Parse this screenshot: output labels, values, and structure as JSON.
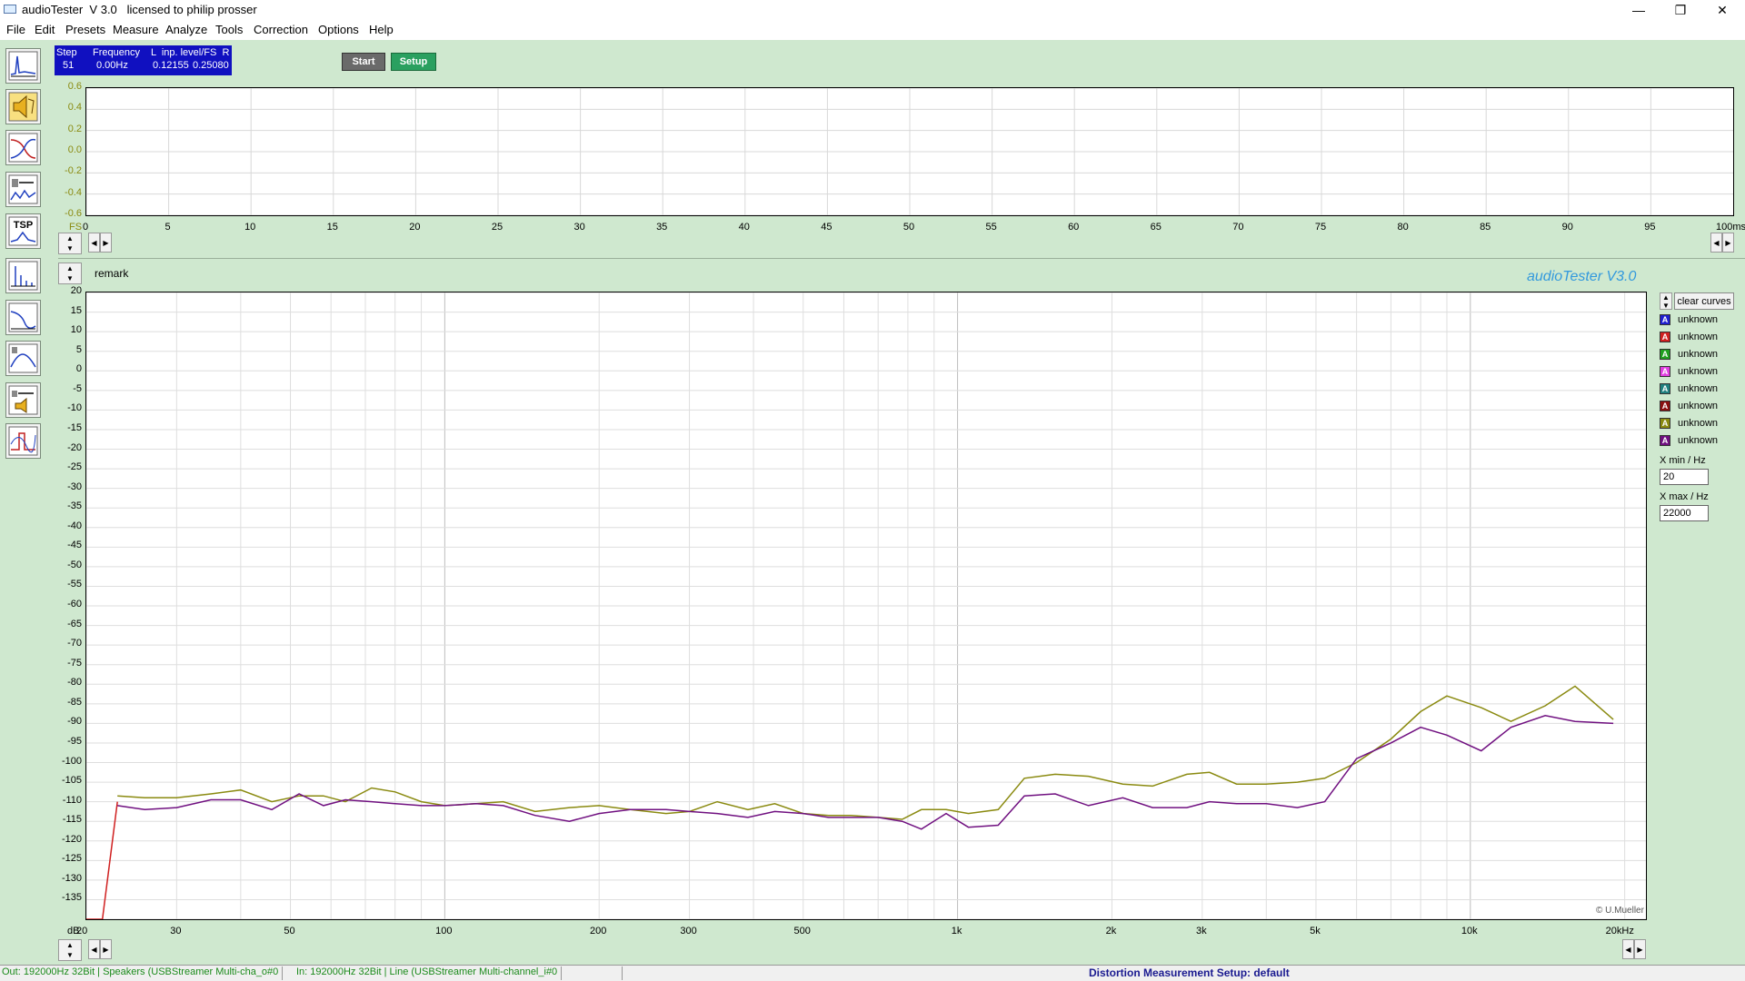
{
  "window": {
    "title": "audioTester  V 3.0   licensed to philip prosser",
    "controls": {
      "minimize": "—",
      "restore": "❐",
      "close": "✕"
    }
  },
  "menu": [
    "File",
    "Edit",
    "Presets",
    "Measure",
    "Analyze",
    "Tools",
    "Correction",
    "Options",
    "Help"
  ],
  "toolbar": {
    "tools": [
      "impulse-tool",
      "speaker-tool",
      "filter-tool",
      "speaker-measure-tool",
      "tsp-tool",
      "spectrum-tool",
      "response-tool",
      "crossover-tool",
      "speaker-compare-tool",
      "step-tool"
    ],
    "tsp_label": "TSP"
  },
  "info": {
    "step_header": "Step",
    "freq_header": "Frequency",
    "level_header": "L  inp. level/FS  R",
    "step_value": "51",
    "freq_value": "0.00Hz",
    "left_value": "0.12155",
    "right_value": "0.25080"
  },
  "buttons": {
    "start": "Start",
    "setup": "Setup"
  },
  "top_plot": {
    "y_ticks": [
      "0.6",
      "0.4",
      "0.2",
      "0.0",
      "-0.2",
      "-0.4",
      "-0.6"
    ],
    "y_unit": "FS",
    "x_ticks": [
      "0",
      "5",
      "10",
      "15",
      "20",
      "25",
      "30",
      "35",
      "40",
      "45",
      "50",
      "55",
      "60",
      "65",
      "70",
      "75",
      "80",
      "85",
      "90",
      "95"
    ],
    "x_unit": "100ms"
  },
  "remark": "remark",
  "brand": "audioTester  V3.0",
  "copyright": "© U.Mueller",
  "legend": {
    "clear_label": "clear curves",
    "curves": [
      {
        "label": "unknown",
        "color": "#2020d0"
      },
      {
        "label": "unknown",
        "color": "#d02020"
      },
      {
        "label": "unknown",
        "color": "#20a020"
      },
      {
        "label": "unknown",
        "color": "#e040e0"
      },
      {
        "label": "unknown",
        "color": "#208080"
      },
      {
        "label": "unknown",
        "color": "#8a1010"
      },
      {
        "label": "unknown",
        "color": "#8a8a10"
      },
      {
        "label": "unknown",
        "color": "#701080"
      }
    ],
    "legend_glyph": "A",
    "xmin_label": "X min / Hz",
    "xmin_value": "20",
    "xmax_label": "X max / Hz",
    "xmax_value": "22000"
  },
  "status": {
    "out": "Out: 192000Hz 32Bit  | Speakers (USBStreamer Multi-cha_o#0",
    "in": "In: 192000Hz 32Bit  | Line (USBStreamer Multi-channel_i#0",
    "setup": "Distortion Measurement Setup:  default"
  },
  "chart_data": {
    "type": "line",
    "title": "",
    "xlabel": "Hz",
    "ylabel": "dB",
    "x_scale": "log",
    "xlim": [
      20,
      22000
    ],
    "ylim": [
      -140,
      20
    ],
    "grid": true,
    "x_tick_labels": [
      {
        "v": 20,
        "t": "20"
      },
      {
        "v": 30,
        "t": "30"
      },
      {
        "v": 50,
        "t": "50"
      },
      {
        "v": 100,
        "t": "100"
      },
      {
        "v": 200,
        "t": "200"
      },
      {
        "v": 300,
        "t": "300"
      },
      {
        "v": 500,
        "t": "500"
      },
      {
        "v": 1000,
        "t": "1k"
      },
      {
        "v": 2000,
        "t": "2k"
      },
      {
        "v": 3000,
        "t": "3k"
      },
      {
        "v": 5000,
        "t": "5k"
      },
      {
        "v": 10000,
        "t": "10k"
      },
      {
        "v": 20000,
        "t": "20kHz"
      }
    ],
    "y_ticks": [
      20,
      15,
      10,
      5,
      0,
      -5,
      -10,
      -15,
      -20,
      -25,
      -30,
      -35,
      -40,
      -45,
      -50,
      -55,
      -60,
      -65,
      -70,
      -75,
      -80,
      -85,
      -90,
      -95,
      -100,
      -105,
      -110,
      -115,
      -120,
      -125,
      -130,
      -135,
      -140
    ],
    "y_unit_label": "dB",
    "series": [
      {
        "color": "#d02020",
        "points": [
          [
            20,
            -140
          ],
          [
            21.5,
            -140
          ],
          [
            23,
            -110
          ]
        ]
      },
      {
        "color": "#8a8a10",
        "points": [
          [
            23,
            -108.5
          ],
          [
            26,
            -109
          ],
          [
            30,
            -109
          ],
          [
            35,
            -108
          ],
          [
            40,
            -107
          ],
          [
            46,
            -110
          ],
          [
            52,
            -108.5
          ],
          [
            58,
            -108.5
          ],
          [
            64,
            -110
          ],
          [
            72,
            -106.5
          ],
          [
            80,
            -107.5
          ],
          [
            90,
            -110
          ],
          [
            100,
            -111
          ],
          [
            115,
            -110.5
          ],
          [
            130,
            -110
          ],
          [
            150,
            -112.5
          ],
          [
            175,
            -111.5
          ],
          [
            200,
            -111
          ],
          [
            230,
            -112
          ],
          [
            270,
            -113
          ],
          [
            300,
            -112.5
          ],
          [
            340,
            -110
          ],
          [
            390,
            -112
          ],
          [
            440,
            -110.5
          ],
          [
            500,
            -113
          ],
          [
            560,
            -113.5
          ],
          [
            620,
            -113.5
          ],
          [
            700,
            -114
          ],
          [
            780,
            -114.5
          ],
          [
            850,
            -112
          ],
          [
            950,
            -112
          ],
          [
            1050,
            -113
          ],
          [
            1200,
            -112
          ],
          [
            1350,
            -104
          ],
          [
            1550,
            -103
          ],
          [
            1800,
            -103.5
          ],
          [
            2100,
            -105.5
          ],
          [
            2400,
            -106
          ],
          [
            2800,
            -103
          ],
          [
            3100,
            -102.5
          ],
          [
            3500,
            -105.5
          ],
          [
            4000,
            -105.5
          ],
          [
            4600,
            -105
          ],
          [
            5200,
            -104
          ],
          [
            6000,
            -100
          ],
          [
            7000,
            -94
          ],
          [
            8000,
            -87
          ],
          [
            9000,
            -83
          ],
          [
            10500,
            -86
          ],
          [
            12000,
            -89.5
          ],
          [
            14000,
            -85.5
          ],
          [
            16000,
            -80.5
          ],
          [
            19000,
            -89
          ]
        ]
      },
      {
        "color": "#701080",
        "points": [
          [
            23,
            -111
          ],
          [
            26,
            -112
          ],
          [
            30,
            -111.5
          ],
          [
            35,
            -109.5
          ],
          [
            40,
            -109.5
          ],
          [
            46,
            -112
          ],
          [
            52,
            -108
          ],
          [
            58,
            -111
          ],
          [
            64,
            -109.5
          ],
          [
            72,
            -110
          ],
          [
            80,
            -110.5
          ],
          [
            90,
            -111
          ],
          [
            100,
            -111
          ],
          [
            115,
            -110.5
          ],
          [
            130,
            -111
          ],
          [
            150,
            -113.5
          ],
          [
            175,
            -115
          ],
          [
            200,
            -113
          ],
          [
            230,
            -112
          ],
          [
            270,
            -112
          ],
          [
            300,
            -112.5
          ],
          [
            340,
            -113
          ],
          [
            390,
            -114
          ],
          [
            440,
            -112.5
          ],
          [
            500,
            -113
          ],
          [
            560,
            -114
          ],
          [
            620,
            -114
          ],
          [
            700,
            -114
          ],
          [
            780,
            -115
          ],
          [
            850,
            -117
          ],
          [
            950,
            -113
          ],
          [
            1050,
            -116.5
          ],
          [
            1200,
            -116
          ],
          [
            1350,
            -108.5
          ],
          [
            1550,
            -108
          ],
          [
            1800,
            -111
          ],
          [
            2100,
            -109
          ],
          [
            2400,
            -111.5
          ],
          [
            2800,
            -111.5
          ],
          [
            3100,
            -110
          ],
          [
            3500,
            -110.5
          ],
          [
            4000,
            -110.5
          ],
          [
            4600,
            -111.5
          ],
          [
            5200,
            -110
          ],
          [
            6000,
            -99
          ],
          [
            7000,
            -95
          ],
          [
            8000,
            -91
          ],
          [
            9000,
            -93
          ],
          [
            10500,
            -97
          ],
          [
            12000,
            -91
          ],
          [
            14000,
            -88
          ],
          [
            16000,
            -89.5
          ],
          [
            19000,
            -90
          ]
        ]
      }
    ]
  }
}
